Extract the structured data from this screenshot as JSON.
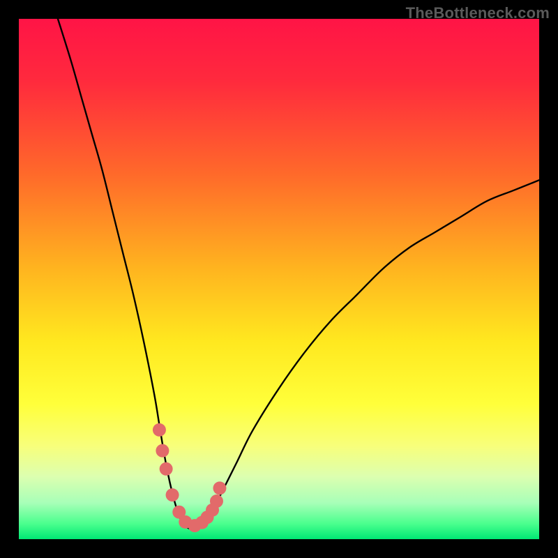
{
  "watermark": "TheBottleneck.com",
  "chart_data": {
    "type": "line",
    "title": "",
    "xlabel": "",
    "ylabel": "",
    "xlim": [
      0,
      100
    ],
    "ylim": [
      0,
      100
    ],
    "grid": false,
    "gradient_stops": [
      {
        "offset": 0.0,
        "color": "#ff1446"
      },
      {
        "offset": 0.12,
        "color": "#ff2a3d"
      },
      {
        "offset": 0.3,
        "color": "#ff6a2a"
      },
      {
        "offset": 0.48,
        "color": "#ffb41f"
      },
      {
        "offset": 0.62,
        "color": "#ffe81f"
      },
      {
        "offset": 0.74,
        "color": "#ffff3a"
      },
      {
        "offset": 0.82,
        "color": "#f8ff7a"
      },
      {
        "offset": 0.88,
        "color": "#dcffb0"
      },
      {
        "offset": 0.93,
        "color": "#a8ffb8"
      },
      {
        "offset": 0.97,
        "color": "#4bff8e"
      },
      {
        "offset": 1.0,
        "color": "#00e874"
      }
    ],
    "series": [
      {
        "name": "bottleneck-curve",
        "type": "line",
        "x": [
          7.5,
          10,
          12,
          14,
          16,
          18,
          20,
          22,
          24,
          26,
          27,
          28,
          29,
          30,
          31,
          32,
          33,
          34,
          35,
          36,
          37,
          38,
          40,
          42,
          45,
          50,
          55,
          60,
          65,
          70,
          75,
          80,
          85,
          90,
          95,
          100
        ],
        "y": [
          100,
          92,
          85,
          78,
          71,
          63,
          55,
          47,
          38,
          28,
          22,
          16,
          11,
          7,
          4,
          2.5,
          2,
          2,
          2.5,
          3.5,
          5,
          7,
          11,
          15,
          21,
          29,
          36,
          42,
          47,
          52,
          56,
          59,
          62,
          65,
          67,
          69
        ]
      },
      {
        "name": "optimal-markers",
        "type": "scatter",
        "x": [
          27.0,
          27.6,
          28.3,
          29.5,
          30.8,
          32.0,
          33.8,
          35.2,
          36.2,
          37.2,
          38.0,
          38.6
        ],
        "y": [
          21.0,
          17.0,
          13.5,
          8.5,
          5.2,
          3.3,
          2.6,
          3.2,
          4.2,
          5.6,
          7.3,
          9.8
        ]
      }
    ],
    "marker_color": "#e26a6a",
    "line_color": "#000000"
  }
}
